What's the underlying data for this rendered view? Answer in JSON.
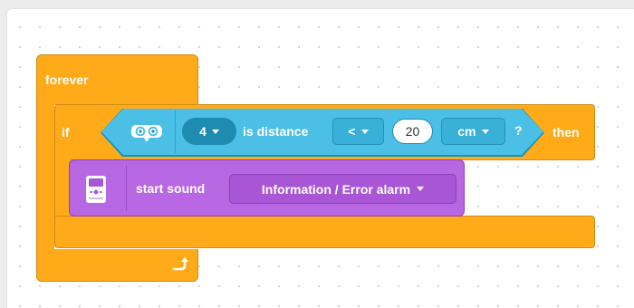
{
  "forever_block": {
    "label": "forever",
    "loop_icon": "loop-arrow-icon"
  },
  "if_block": {
    "if_label": "if",
    "then_label": "then"
  },
  "condition": {
    "sensor_icon": "ultrasonic-sensor-icon",
    "port": "4",
    "text": "is distance",
    "operator": "<",
    "value": "20",
    "unit": "cm",
    "suffix": "?"
  },
  "sound_block": {
    "icon": "ev3-brick-icon",
    "text": "start sound",
    "sound": "Information / Error alarm"
  },
  "colors": {
    "control": "#ffab19",
    "sensor": "#4cbfe6",
    "sound": "#b867e2"
  }
}
